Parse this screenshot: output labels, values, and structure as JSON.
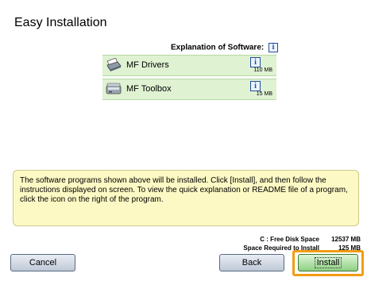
{
  "window": {
    "title": "Easy Installation"
  },
  "explanation": {
    "label": "Explanation of Software:",
    "icon": "info-icon"
  },
  "software": [
    {
      "name": "MF Drivers",
      "size": "110 MB",
      "icon": "printer-icon"
    },
    {
      "name": "MF Toolbox",
      "size": "15 MB",
      "icon": "scanner-icon"
    }
  ],
  "message": "The software programs shown above will be installed. Click [Install], and then follow the instructions displayed on screen. To view the quick explanation or README file of a program, click the icon on the right of the program.",
  "disk": {
    "free_label": "C : Free Disk Space",
    "free_value": "12537 MB",
    "required_label": "Space Required to Install",
    "required_value": "125 MB"
  },
  "buttons": {
    "cancel": "Cancel",
    "back": "Back",
    "install": "Install"
  },
  "colors": {
    "row_bg": "#dff2d2",
    "message_bg": "#fdf9c4",
    "highlight": "#f39c12"
  }
}
